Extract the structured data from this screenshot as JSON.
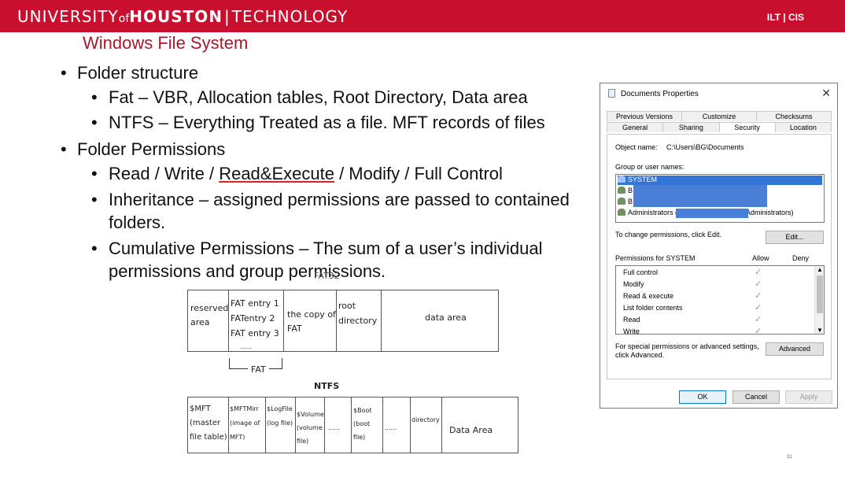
{
  "header": {
    "uni_part1": "UNIVERSITY",
    "uni_of": "of",
    "uni_houston": "HOUSTON",
    "uni_sep": "|",
    "uni_tech": "TECHNOLOGY",
    "ilt_cis": "ILT | CIS",
    "bar_color": "#c8102e"
  },
  "slide": {
    "title": "Windows File System",
    "bullets": {
      "folder_structure": "Folder structure",
      "fat_line": "Fat – VBR, Allocation tables, Root Directory, Data area",
      "ntfs_line": "NTFS – Everything Treated as a file. MFT records of files",
      "folder_permissions": "Folder Permissions",
      "perm_pre": "Read / Write / ",
      "perm_underlined": "Read&Execute",
      "perm_post": " / Modify / Full Control",
      "inheritance": "Inheritance – assigned permissions are passed to contained folders.",
      "cumulative": "Cumulative Permissions – The sum of a user’s individual permissions and group permissions."
    },
    "page_number": "31"
  },
  "dialog": {
    "title": "Documents Properties",
    "close_glyph": "✕",
    "tabs_top": [
      "Previous Versions",
      "Customize",
      "Checksums"
    ],
    "tabs_bottom": [
      "General",
      "Sharing",
      "Security",
      "Location"
    ],
    "active_tab": "Security",
    "object_name_label": "Object name:",
    "object_name_value": "C:\\Users\\BG\\Documents",
    "group_label": "Group or user names:",
    "users": [
      "SYSTEM",
      "B",
      "B",
      "Administrators (",
      "Administrators)"
    ],
    "change_hint": "To change permissions, click Edit.",
    "edit_button": "Edit...",
    "perms_for": "Permissions for SYSTEM",
    "allow_label": "Allow",
    "deny_label": "Deny",
    "permissions": [
      "Full control",
      "Modify",
      "Read & execute",
      "List folder contents",
      "Read",
      "Write"
    ],
    "check_glyph": "✓",
    "special_hint_1": "For special permissions or advanced settings,",
    "special_hint_2": "click Advanced.",
    "advanced_button": "Advanced",
    "ok_button": "OK",
    "cancel_button": "Cancel",
    "apply_button": "Apply",
    "selection_color": "#3375d6"
  },
  "fat_diagram": {
    "title": "FAT32",
    "reserved_1": "reserved",
    "reserved_2": "area",
    "fat_entries": [
      "FAT entry 1",
      "FATentry 2",
      "FAT entry 3",
      "......"
    ],
    "copy_1": "the copy of",
    "copy_2": "FAT",
    "root_1": "root",
    "root_2": "directory",
    "data_area": "data area",
    "fat_label": "FAT"
  },
  "ntfs_diagram": {
    "title": "NTFS",
    "mft": [
      "$MFT",
      "(master",
      "file table)"
    ],
    "mftmirr": [
      "$MFTMirr",
      "(image of",
      "MFT)"
    ],
    "logfile": [
      "$LogFile",
      "(log file)"
    ],
    "volume": [
      "$Volume",
      "(volume",
      "file)"
    ],
    "dots1": "......",
    "boot": [
      "$Boot",
      "(boot",
      "file)"
    ],
    "dots2": "......",
    "directory": "directory",
    "data_area": "Data Area"
  }
}
